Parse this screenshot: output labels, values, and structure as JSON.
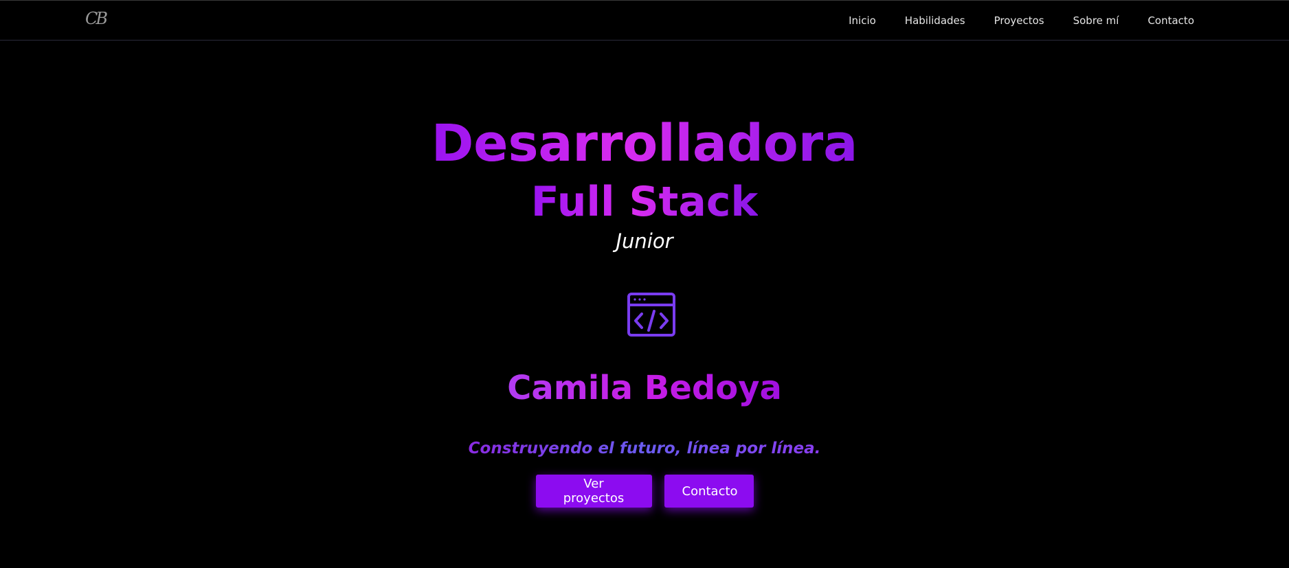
{
  "nav": {
    "logo": "CB",
    "links": [
      "Inicio",
      "Habilidades",
      "Proyectos",
      "Sobre mí",
      "Contacto"
    ]
  },
  "hero": {
    "title_line1": "Desarrolladora",
    "title_line2": "Full Stack",
    "level": "Junior",
    "icon": "code-window-icon",
    "name": "Camila Bedoya",
    "tagline": "Construyendo el futuro, línea por línea.",
    "buttons": {
      "projects_label": "Ver proyectos",
      "contact_label": "Contacto"
    }
  },
  "colors": {
    "background": "#000000",
    "accent": "#8c0cf0",
    "gradient_start": "#9a14f0",
    "gradient_mid": "#d92cf0",
    "tagline": "#7a3ce8",
    "icon": "#7a3cf0"
  }
}
